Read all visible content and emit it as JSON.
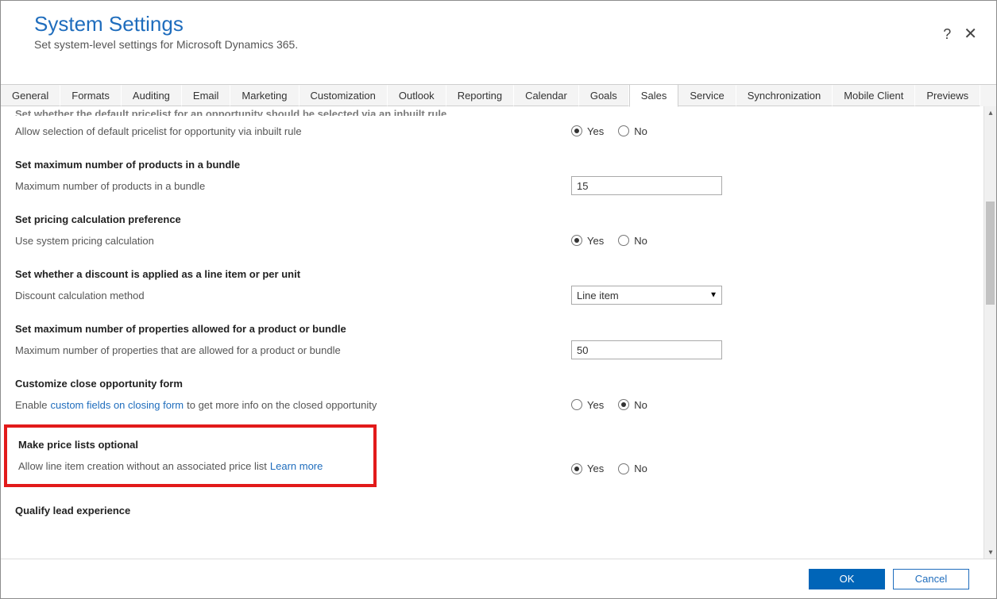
{
  "header": {
    "title": "System Settings",
    "subtitle": "Set system-level settings for Microsoft Dynamics 365."
  },
  "tabs": [
    "General",
    "Formats",
    "Auditing",
    "Email",
    "Marketing",
    "Customization",
    "Outlook",
    "Reporting",
    "Calendar",
    "Goals",
    "Sales",
    "Service",
    "Synchronization",
    "Mobile Client",
    "Previews"
  ],
  "active_tab": "Sales",
  "radio_labels": {
    "yes": "Yes",
    "no": "No"
  },
  "sections": {
    "default_pricelist": {
      "heading": "Set whether the default pricelist for an opportunity should be selected via an inbuilt rule",
      "label": "Allow selection of default pricelist for opportunity via inbuilt rule",
      "value": "Yes"
    },
    "max_bundle": {
      "heading": "Set maximum number of products in a bundle",
      "label": "Maximum number of products in a bundle",
      "value": "15"
    },
    "pricing_pref": {
      "heading": "Set pricing calculation preference",
      "label": "Use system pricing calculation",
      "value": "Yes"
    },
    "discount": {
      "heading": "Set whether a discount is applied as a line item or per unit",
      "label": "Discount calculation method",
      "value": "Line item"
    },
    "max_props": {
      "heading": "Set maximum number of properties allowed for a product or bundle",
      "label": "Maximum number of properties that are allowed for a product or bundle",
      "value": "50"
    },
    "close_opp": {
      "heading": "Customize close opportunity form",
      "label_prefix": "Enable ",
      "label_link": "custom fields on closing form",
      "label_suffix": " to get more info on the closed opportunity",
      "value": "No"
    },
    "pricelists_optional": {
      "heading": "Make price lists optional",
      "label": "Allow line item creation without an associated price list ",
      "learn_more": "Learn more",
      "value": "Yes"
    },
    "qualify_lead": {
      "heading": "Qualify lead experience"
    }
  },
  "footer": {
    "ok": "OK",
    "cancel": "Cancel"
  }
}
